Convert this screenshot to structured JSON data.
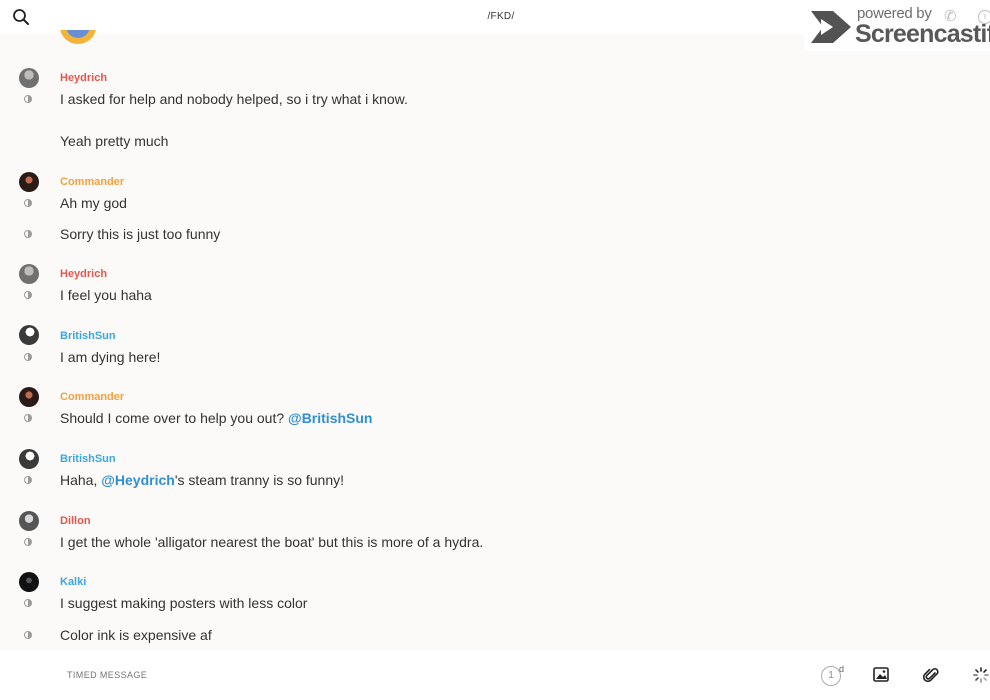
{
  "header": {
    "channel": "/FKD/"
  },
  "watermark": {
    "line1": "powered by",
    "line2": "Screencastify"
  },
  "messages": [
    {
      "author": "Heydrich",
      "text": "I asked for help and nobody helped, so i try what i know."
    },
    {
      "text": "Yeah pretty much"
    },
    {
      "author": "Commander",
      "text": "Ah my god"
    },
    {
      "text": "Sorry this is just too funny"
    },
    {
      "author": "Heydrich",
      "text": "I feel you haha"
    },
    {
      "author": "BritishSun",
      "text": "I am dying here!"
    },
    {
      "author": "Commander",
      "text": "Should I come over to help you out?",
      "mention": "@BritishSun"
    },
    {
      "author": "BritishSun",
      "text_before": "Haha,",
      "mention": "@Heydrich",
      "text_after": "'s steam tranny is so funny!"
    },
    {
      "author": "Dillon",
      "text": "I get the whole 'alligator nearest the boat' but this is more of a hydra."
    },
    {
      "author": "Kalki",
      "text": "I suggest making posters with less color"
    },
    {
      "text": "Color ink is expensive af"
    }
  ],
  "composer": {
    "placeholder": "TIMED MESSAGE",
    "timer_value": "1",
    "timer_unit": "d"
  },
  "icons": {
    "search": "search-icon",
    "image": "image-icon",
    "attach": "paperclip-icon",
    "spinner": "loading-spinner-icon",
    "timer": "timer-icon"
  },
  "colors": {
    "author_red": "#e2574c",
    "author_orange": "#f0a140",
    "author_blue": "#3aa6d9",
    "mention": "#2f8fd0",
    "background": "#fbfaf9"
  }
}
